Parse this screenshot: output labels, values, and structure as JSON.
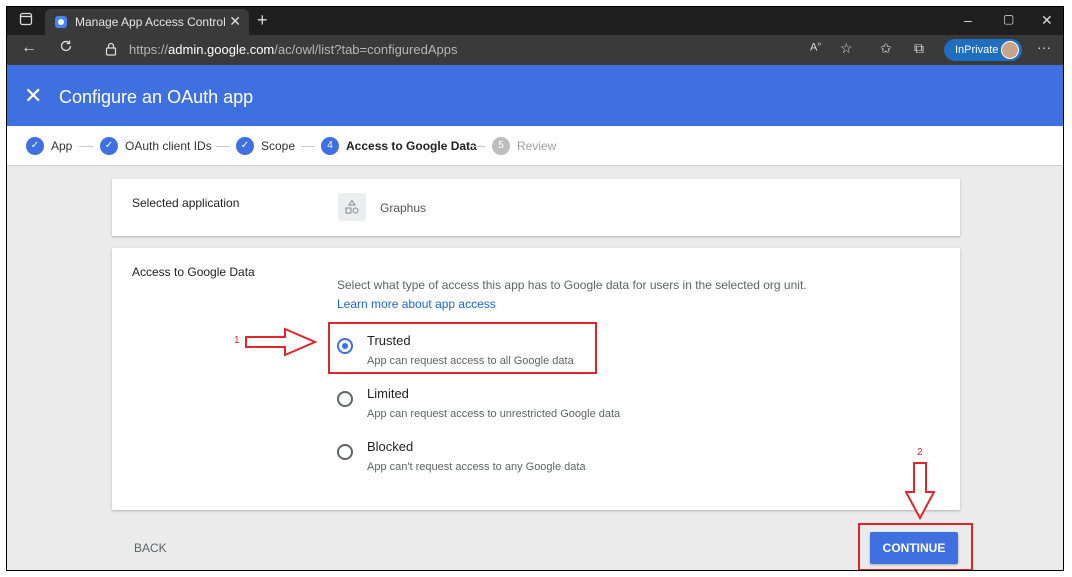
{
  "browser": {
    "tab_title": "Manage App Access Control - Ac",
    "tab_close": "✕",
    "new_tab": "+",
    "url_prefix": "https://",
    "url_host": "admin.google.com",
    "url_path": "/ac/owl/list?tab=configuredApps",
    "inprivate_label": "InPrivate",
    "window_controls": [
      "–",
      "▢",
      "✕"
    ],
    "toolbar_icons": [
      "read-aloud-icon",
      "favorites-add-icon",
      "favorites-icon",
      "collections-icon",
      "more-icon"
    ]
  },
  "header": {
    "close_label": "✕",
    "title": "Configure an OAuth app"
  },
  "stepper": {
    "steps": [
      {
        "label": "App",
        "state": "done",
        "marker": "✓"
      },
      {
        "label": "OAuth client IDs",
        "state": "done",
        "marker": "✓"
      },
      {
        "label": "Scope",
        "state": "done",
        "marker": "✓"
      },
      {
        "label": "Access to Google Data",
        "state": "active",
        "marker": "4"
      },
      {
        "label": "Review",
        "state": "inactive",
        "marker": "5"
      }
    ]
  },
  "selected_app": {
    "label": "Selected application",
    "app_name": "Graphus"
  },
  "access": {
    "label": "Access to Google Data",
    "description": "Select what type of access this app has to Google data for users in the selected org unit.",
    "learn_more": "Learn more about app access",
    "options": [
      {
        "title": "Trusted",
        "desc": "App can request access to all Google data",
        "checked": true
      },
      {
        "title": "Limited",
        "desc": "App can request access to unrestricted Google data",
        "checked": false
      },
      {
        "title": "Blocked",
        "desc": "App can't request access to any Google data",
        "checked": false
      }
    ]
  },
  "footer": {
    "back_label": "BACK",
    "continue_label": "CONTINUE"
  },
  "annotations": {
    "arrow1_number": "1",
    "arrow2_number": "2",
    "color": "#e0262b"
  },
  "colors": {
    "accent": "#3f70e0",
    "link": "#1a66d6"
  }
}
